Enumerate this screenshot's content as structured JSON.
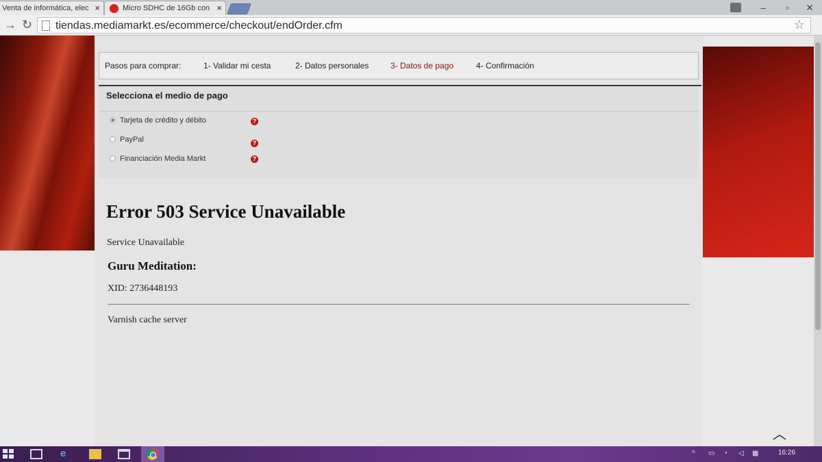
{
  "browser": {
    "tabs": [
      {
        "title": "Venta de informática, elec"
      },
      {
        "title": "Micro SDHC de 16Gb con"
      }
    ],
    "address_bar": {
      "url": "tiendas.mediamarkt.es/ecommerce/checkout/endOrder.cfm"
    },
    "icons": [
      "back-arrow-icon",
      "reload-icon",
      "page-icon",
      "bookmark-star-icon",
      "user-icon",
      "minimize-icon",
      "maximize-icon",
      "close-icon"
    ]
  },
  "checkout": {
    "steps_label": "Pasos para comprar:",
    "steps": [
      {
        "label": "1- Validar mi cesta",
        "active": false
      },
      {
        "label": "2- Datos personales",
        "active": false
      },
      {
        "label": "3- Datos de pago",
        "active": true
      },
      {
        "label": "4- Confirmación",
        "active": false
      }
    ],
    "payment": {
      "title": "Selecciona el medio de pago",
      "options": [
        {
          "label": "Tarjeta de crédito y débito",
          "selected": true
        },
        {
          "label": "PayPal",
          "selected": false
        },
        {
          "label": "Financiación Media Markt",
          "selected": false
        }
      ],
      "help_glyph": "?"
    }
  },
  "error": {
    "heading": "Error 503 Service Unavailable",
    "message": "Service Unavailable",
    "subheading": "Guru Meditation:",
    "xid": "XID: 2736448193",
    "footer": "Varnish cache server"
  },
  "taskbar": {
    "clock": "16:26",
    "apps": [
      "windows-start-icon",
      "task-view-icon",
      "edge-icon",
      "file-explorer-icon",
      "store-icon",
      "chrome-icon"
    ]
  },
  "colors": {
    "active_step": "#8a1010",
    "brand_red": "#c8201a",
    "taskbar": "#5a2f7a"
  }
}
